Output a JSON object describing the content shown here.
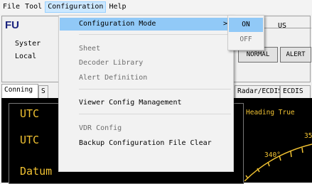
{
  "menubar": {
    "items": [
      {
        "label": "File"
      },
      {
        "label": "Tool"
      },
      {
        "label": "Configuration"
      },
      {
        "label": "Help"
      }
    ]
  },
  "header": {
    "logo_text": "FU",
    "system_label": "Syster",
    "local_label": "Local",
    "status_title": "US",
    "buttons": {
      "normal": "NORMAL",
      "alert": "ALERT"
    }
  },
  "tabs": [
    {
      "label": "Conning"
    },
    {
      "label": "S"
    },
    {
      "label": "Radar/ECDIS"
    },
    {
      "label": "ECDIS"
    }
  ],
  "panel": {
    "utc1": "UTC",
    "utc2": "UTC",
    "datum": "Datum",
    "heading_label": "Heading True",
    "heading_deg1": "340°",
    "heading_deg2": "35"
  },
  "config_menu": {
    "configuration_mode": "Configuration Mode",
    "sheet": "Sheet",
    "decoder_library": "Decoder Library",
    "alert_definition": "Alert Definition",
    "viewer_config": "Viewer Config Management",
    "vdr_config": "VDR Config",
    "backup_clear": "Backup Configuration File Clear",
    "arrow": ">"
  },
  "submenu": {
    "on": "ON",
    "off": "OFF"
  }
}
